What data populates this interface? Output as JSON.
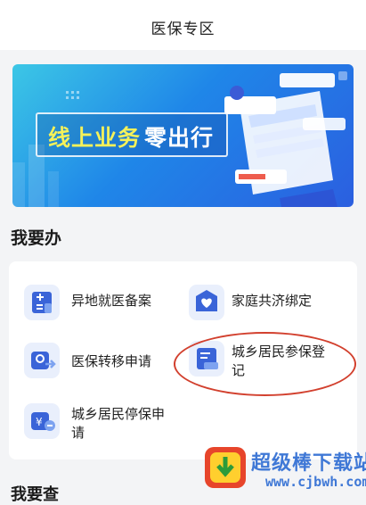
{
  "header": {
    "title": "医保专区"
  },
  "banner": {
    "slogan_part1": "线上业务",
    "slogan_part2": "零出行"
  },
  "section": {
    "title": "我要办"
  },
  "services": [
    {
      "label": "异地就医备案",
      "icon": "plus-minus-calculator-icon"
    },
    {
      "label": "家庭共济绑定",
      "icon": "heart-shield-icon"
    },
    {
      "label": "医保转移申请",
      "icon": "transfer-card-icon"
    },
    {
      "label": "城乡居民参保登记",
      "label_line1": "城乡居民参保登",
      "label_line2": "记",
      "icon": "register-card-icon"
    },
    {
      "label": "城乡居民停保申请",
      "label_line1": "城乡居民停保申",
      "label_line2": "请",
      "icon": "yuan-minus-icon"
    }
  ],
  "next_section": {
    "title": "我要查"
  },
  "watermark": {
    "name": "超级棒下载站",
    "url": "www.cjbwh.com"
  },
  "colors": {
    "accent": "#3f78d6",
    "highlight": "#d2402e",
    "banner_yellow": "#f4f15a"
  }
}
